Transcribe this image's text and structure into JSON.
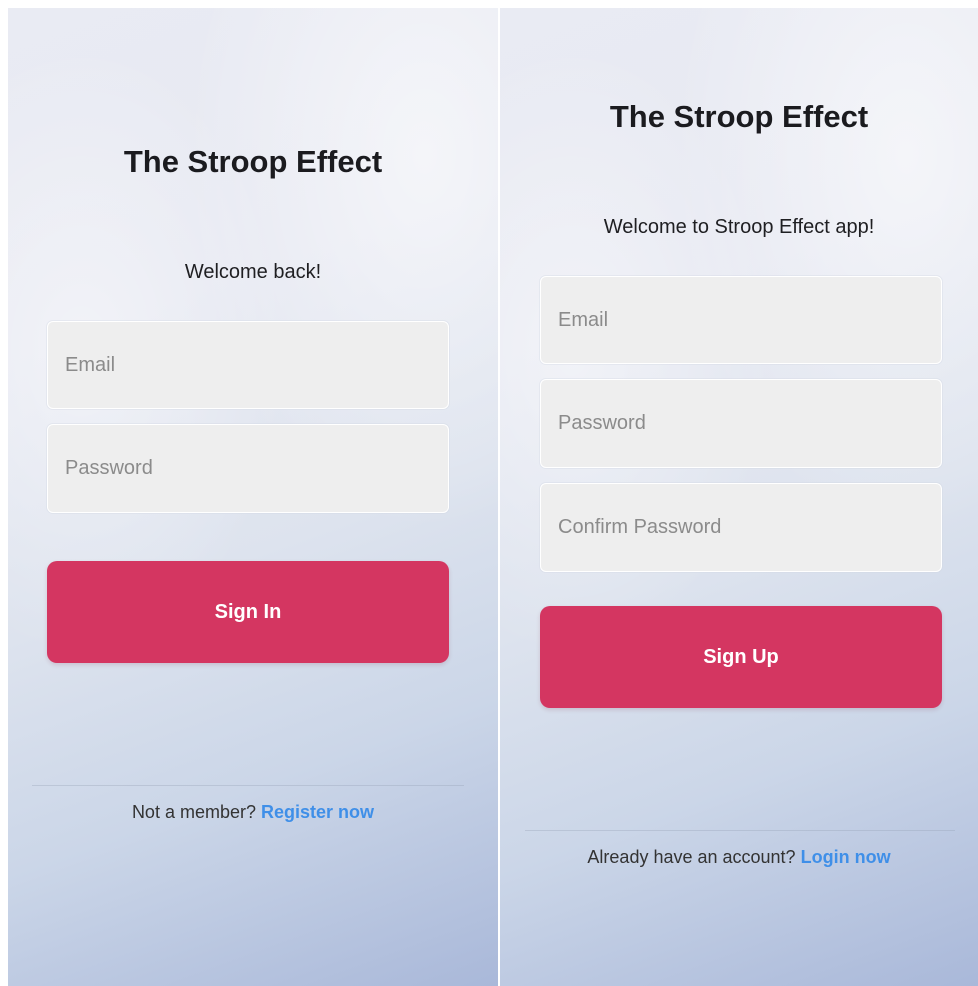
{
  "signin": {
    "title": "The Stroop Effect",
    "subtitle": "Welcome back!",
    "email_placeholder": "Email",
    "password_placeholder": "Password",
    "button_label": "Sign In",
    "footer_prompt": "Not a member?",
    "footer_link": "Register now"
  },
  "signup": {
    "title": "The Stroop Effect",
    "subtitle": "Welcome to Stroop Effect app!",
    "email_placeholder": "Email",
    "password_placeholder": "Password",
    "confirm_placeholder": "Confirm Password",
    "button_label": "Sign Up",
    "footer_prompt": "Already have an account?",
    "footer_link": "Login now"
  },
  "colors": {
    "accent": "#d43661",
    "link": "#3f8fe8",
    "field_background": "#eeeeee"
  }
}
